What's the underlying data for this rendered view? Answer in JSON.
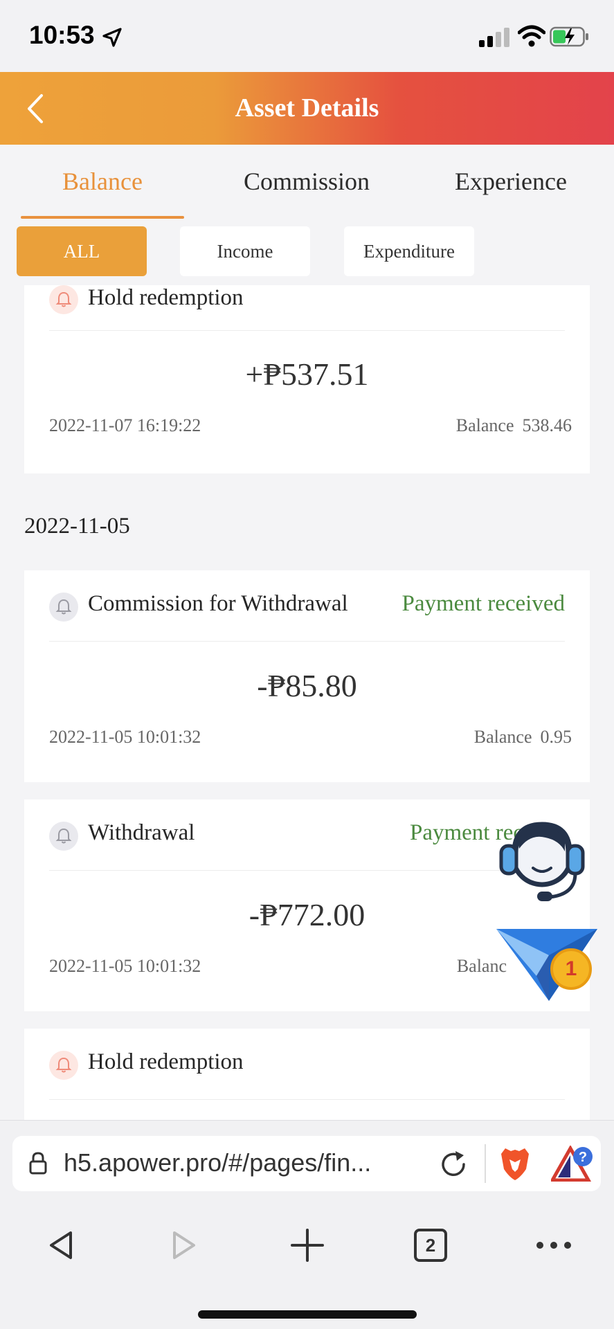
{
  "status_bar": {
    "time": "10:53"
  },
  "header": {
    "title": "Asset Details"
  },
  "tabs": [
    {
      "label": "Balance",
      "active": true
    },
    {
      "label": "Commission",
      "active": false
    },
    {
      "label": "Experience",
      "active": false
    }
  ],
  "filters": [
    {
      "label": "ALL",
      "active": true
    },
    {
      "label": "Income",
      "active": false
    },
    {
      "label": "Expenditure",
      "active": false
    }
  ],
  "records": [
    {
      "title": "Hold redemption",
      "status": "",
      "amount": "+₱537.51",
      "datetime": "2022-11-07 16:19:22",
      "balance_label": "Balance",
      "balance_value": "538.46",
      "icon": "bell-icon",
      "icon_tone": "pink"
    },
    {
      "title": "Commission for Withdrawal",
      "status": "Payment received",
      "amount": "-₱85.80",
      "datetime": "2022-11-05 10:01:32",
      "balance_label": "Balance",
      "balance_value": "0.95",
      "icon": "bell-icon",
      "icon_tone": "gray"
    },
    {
      "title": "Withdrawal",
      "status": "Payment rec",
      "amount": "-₱772.00",
      "datetime": "2022-11-05 10:01:32",
      "balance_label": "Balanc",
      "balance_value": "",
      "icon": "bell-icon",
      "icon_tone": "gray"
    },
    {
      "title": "Hold redemption",
      "status": "",
      "icon": "bell-icon",
      "icon_tone": "pink"
    }
  ],
  "group_date": "2022-11-05",
  "floating": {
    "notification_count": "1"
  },
  "browser": {
    "url": "h5.apower.pro/#/pages/fin...",
    "tab_count": "2"
  },
  "colors": {
    "accent": "#e8913a",
    "header_gradient_start": "#eea23a",
    "header_gradient_end": "#e3434b",
    "status_green": "#4b8a3f"
  }
}
